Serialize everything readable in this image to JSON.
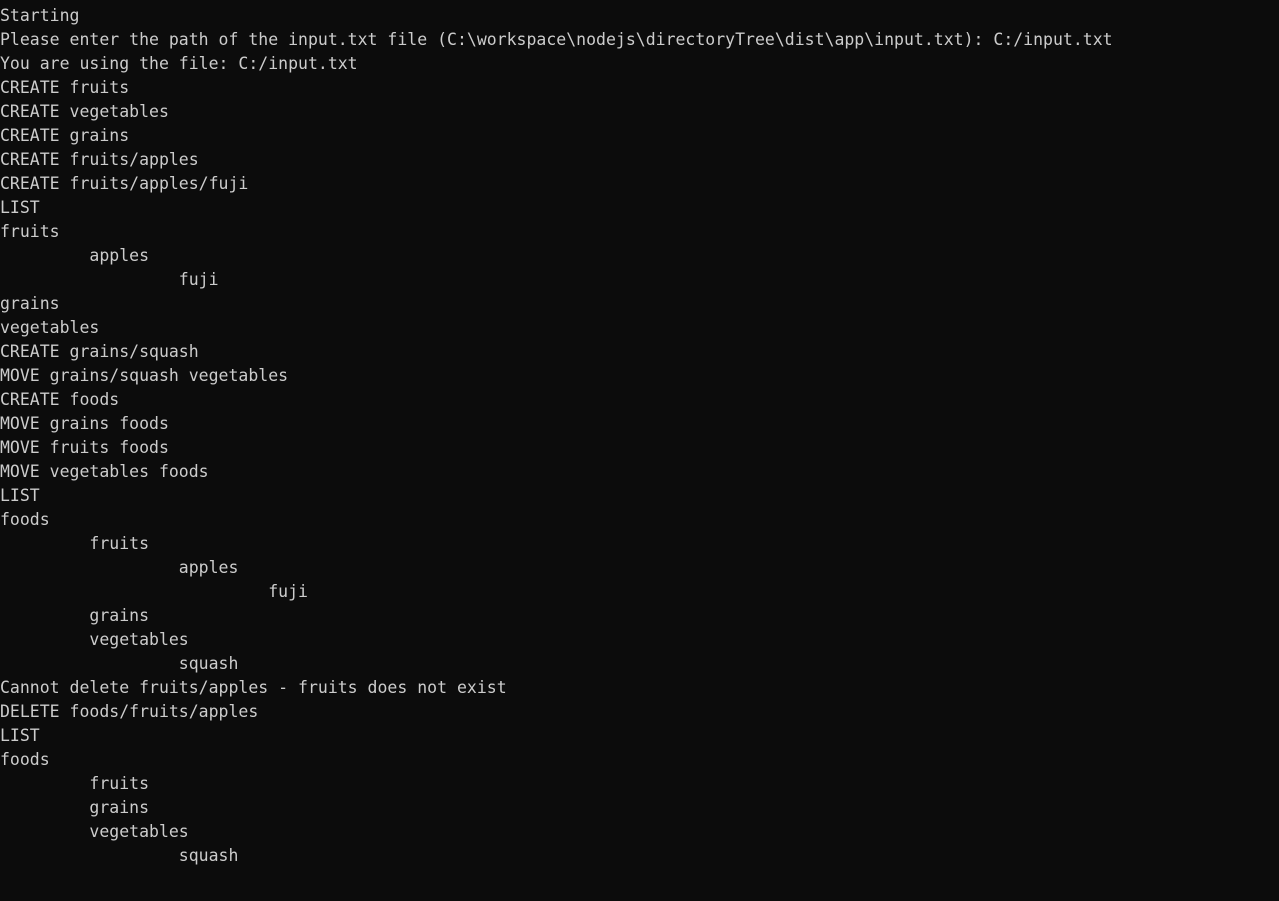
{
  "window": {
    "kind": "console-terminal",
    "background_color": "#0c0c0c",
    "foreground_color": "#cccccc"
  },
  "terminal": {
    "lines": [
      "Starting",
      "Please enter the path of the input.txt file (C:\\workspace\\nodejs\\directoryTree\\dist\\app\\input.txt): C:/input.txt",
      "You are using the file: C:/input.txt",
      "CREATE fruits",
      "CREATE vegetables",
      "CREATE grains",
      "CREATE fruits/apples",
      "CREATE fruits/apples/fuji",
      "LIST",
      "fruits",
      "         apples",
      "                  fuji",
      "grains",
      "vegetables",
      "CREATE grains/squash",
      "MOVE grains/squash vegetables",
      "CREATE foods",
      "MOVE grains foods",
      "MOVE fruits foods",
      "MOVE vegetables foods",
      "LIST",
      "foods",
      "         fruits",
      "                  apples",
      "                           fuji",
      "         grains",
      "         vegetables",
      "                  squash",
      "Cannot delete fruits/apples - fruits does not exist",
      "DELETE foods/fruits/apples",
      "LIST",
      "foods",
      "         fruits",
      "         grains",
      "         vegetables",
      "                  squash"
    ]
  }
}
